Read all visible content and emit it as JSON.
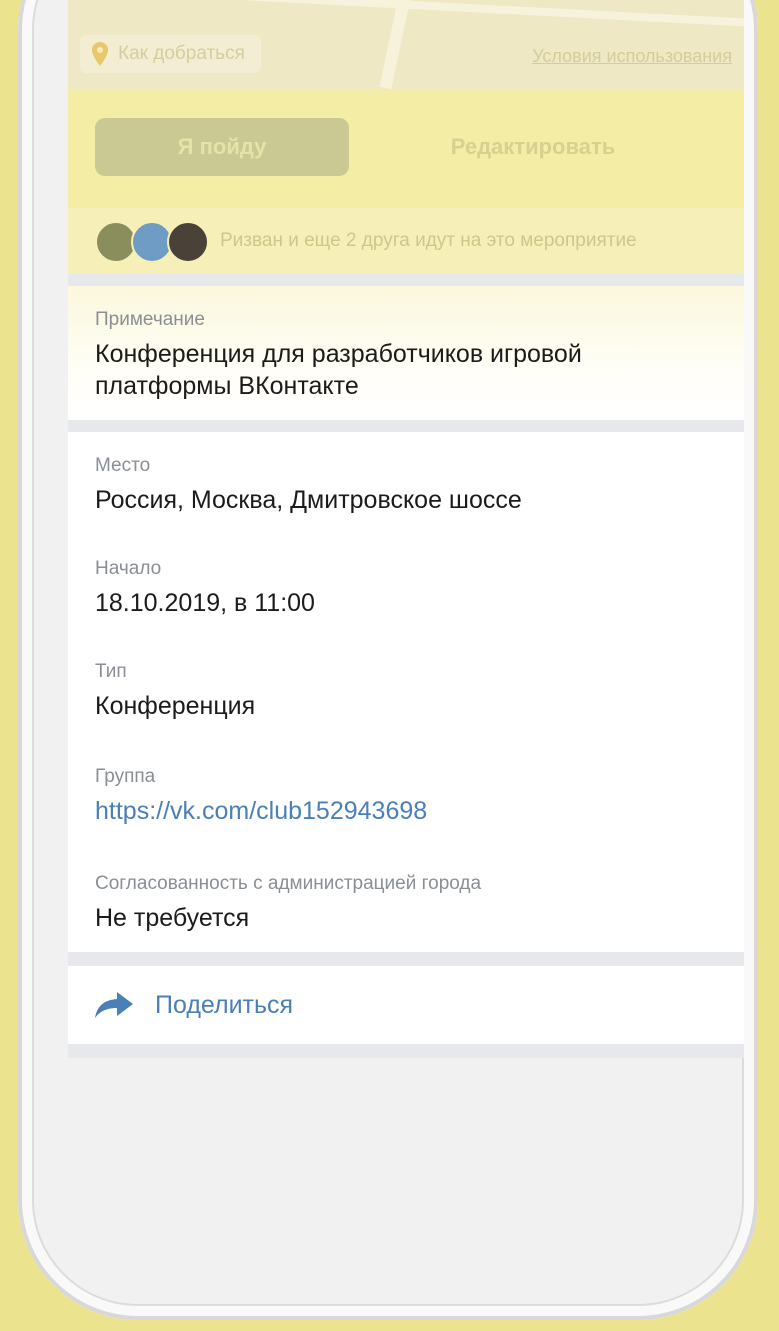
{
  "map": {
    "route_link": "Как добраться",
    "terms_link": "Условия использования"
  },
  "actions": {
    "go_label": "Я пойду",
    "edit_label": "Редактировать"
  },
  "friends": {
    "text": "Ризван и еще 2 друга идут на это мероприятие"
  },
  "note": {
    "label": "Примечание",
    "value": "Конференция для разработчиков игровой платформы ВКонтакте"
  },
  "info": {
    "place_label": "Место",
    "place_value": "Россия, Москва, Дмитровское шоссе",
    "start_label": "Начало",
    "start_value": "18.10.2019, в 11:00",
    "type_label": "Тип",
    "type_value": "Конференция",
    "group_label": "Группа",
    "group_value": "https://vk.com/club152943698",
    "approval_label": "Согласованность с администрацией города",
    "approval_value": "Не требуется"
  },
  "share": {
    "label": "Поделиться"
  },
  "colors": {
    "background": "#ece38f",
    "link": "#4a7fb8"
  }
}
